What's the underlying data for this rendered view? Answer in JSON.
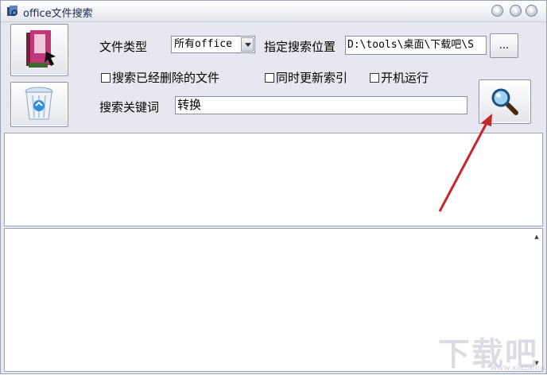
{
  "window": {
    "title": "office文件搜索"
  },
  "filetype": {
    "label": "文件类型",
    "selected": "所有office"
  },
  "location": {
    "label": "指定搜索位置",
    "path": "D:\\tools\\桌面\\下载吧\\S",
    "browse_label": "..."
  },
  "options": [
    {
      "label": "搜索已经删除的文件"
    },
    {
      "label": "同时更新索引"
    },
    {
      "label": "开机运行"
    }
  ],
  "keyword": {
    "label": "搜索关键词",
    "value": "转换"
  },
  "watermark": {
    "text": "下载吧",
    "url": "www.xiazaiba.com"
  },
  "colors": {
    "annotation_arrow": "#c8262a",
    "panel_bg": "#e6e7ef"
  }
}
